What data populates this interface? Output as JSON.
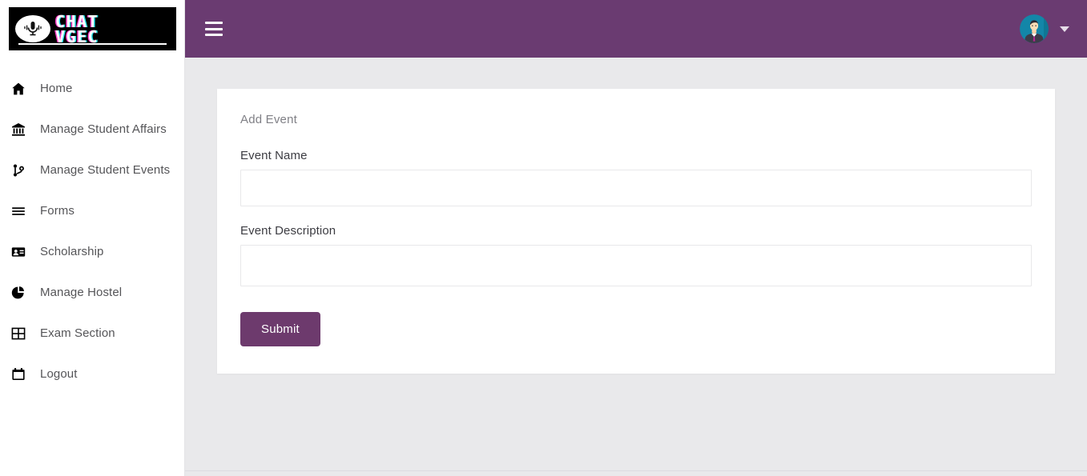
{
  "brand": {
    "logo_line1": "CHAT",
    "logo_line2": "VGEC",
    "logo_icon": "microphone-icon",
    "colors": {
      "header_purple": "#6a3b71",
      "button_purple": "#6d3a6d",
      "page_background": "#e9e9eb",
      "logo_background": "#000000",
      "logo_magenta": "#ff3ec8",
      "logo_cyan": "#26e3e8"
    }
  },
  "sidebar": {
    "items": [
      {
        "label": "Home",
        "icon": "home-icon"
      },
      {
        "label": "Manage Student Affairs",
        "icon": "bank-icon"
      },
      {
        "label": "Manage Student Events",
        "icon": "git-branch-icon"
      },
      {
        "label": "Forms",
        "icon": "list-lines-icon"
      },
      {
        "label": "Scholarship",
        "icon": "id-card-icon"
      },
      {
        "label": "Manage Hostel",
        "icon": "pie-chart-icon"
      },
      {
        "label": "Exam Section",
        "icon": "grid-table-icon"
      },
      {
        "label": "Logout",
        "icon": "calendar-icon"
      }
    ]
  },
  "topbar": {
    "menu_toggle": "hamburger-menu-icon",
    "avatar": "user-avatar",
    "dropdown": "chevron-down-icon"
  },
  "main": {
    "card_title": "Add Event",
    "fields": [
      {
        "label": "Event Name",
        "value": "",
        "placeholder": ""
      },
      {
        "label": "Event Description",
        "value": "",
        "placeholder": ""
      }
    ],
    "submit_label": "Submit"
  }
}
